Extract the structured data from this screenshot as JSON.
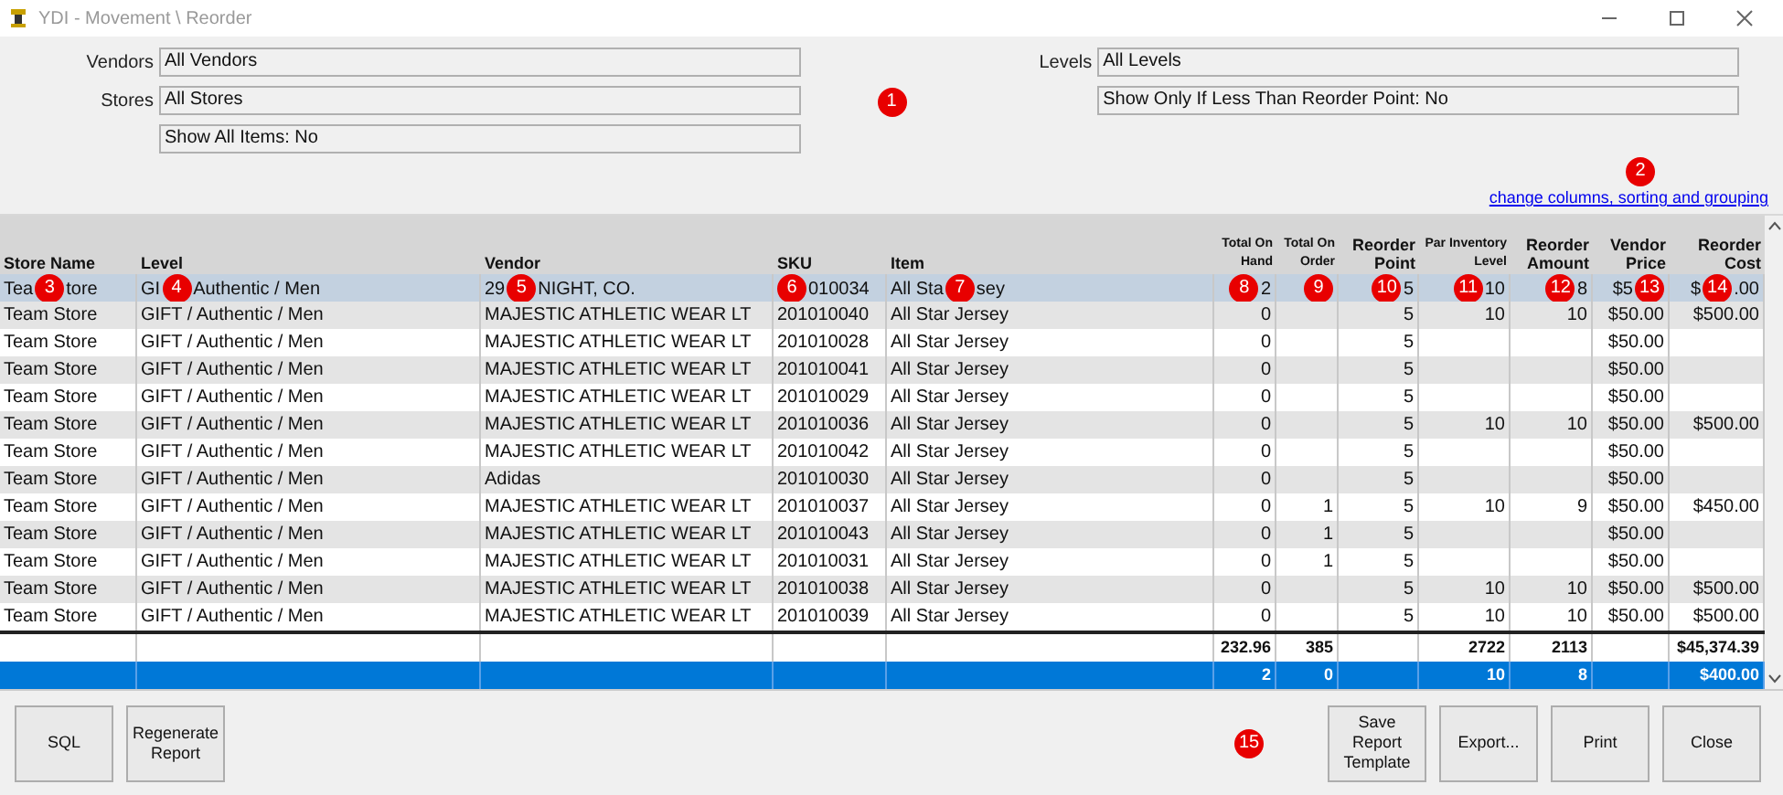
{
  "window": {
    "title": "YDI - Movement \\ Reorder"
  },
  "filters": {
    "left": [
      {
        "label": "Vendors",
        "value": "All Vendors"
      },
      {
        "label": "Stores",
        "value": "All Stores"
      },
      {
        "value": "Show All Items: No"
      }
    ],
    "callout": "1",
    "right": [
      {
        "label": "Levels",
        "value": "All Levels"
      },
      {
        "value": "Show Only If Less Than Reorder Point: No"
      }
    ]
  },
  "link_callout": "2",
  "link": "change columns, sorting and grouping",
  "table": {
    "columns": [
      {
        "label": "Store Name",
        "kind": "normal"
      },
      {
        "label": "Level",
        "kind": "normal"
      },
      {
        "label": "Vendor",
        "kind": "normal"
      },
      {
        "label": "SKU",
        "kind": "normal"
      },
      {
        "label": "Item",
        "kind": "normal"
      },
      {
        "label": "Total On Hand",
        "kind": "small"
      },
      {
        "label": "Total On Order",
        "kind": "small"
      },
      {
        "label": "Reorder Point",
        "kind": "normal"
      },
      {
        "label": "Par Inventory Level",
        "kind": "small"
      },
      {
        "label": "Reorder Amount",
        "kind": "normal"
      },
      {
        "label": "Vendor Price",
        "kind": "normal"
      },
      {
        "label": "Reorder Cost",
        "kind": "normal"
      }
    ],
    "rows": [
      {
        "selected": true,
        "cells": [
          {
            "before": "Tea",
            "callout": "3",
            "after": "tore"
          },
          {
            "before": "GI",
            "callout": "4",
            "after": "Authentic / Men"
          },
          {
            "before": "29",
            "callout": "5",
            "after": "NIGHT, CO."
          },
          {
            "callout": "6",
            "after": "010034"
          },
          {
            "before": "All Sta",
            "callout": "7",
            "after": "sey"
          },
          {
            "callout": "8",
            "after": "2"
          },
          {
            "callout": "9"
          },
          {
            "callout": "10",
            "after": "5"
          },
          {
            "callout": "11",
            "after": "10"
          },
          {
            "callout": "12",
            "after": "8"
          },
          {
            "before": "$5",
            "callout": "13"
          },
          {
            "before": "$",
            "callout": "14",
            "after": ".00"
          }
        ]
      },
      {
        "selected": false,
        "cells": [
          "Team Store",
          "GIFT / Authentic / Men",
          "MAJESTIC ATHLETIC WEAR LT",
          "201010040",
          "All Star Jersey",
          "0",
          null,
          "5",
          "10",
          "10",
          "$50.00",
          "$500.00"
        ]
      },
      {
        "selected": false,
        "cells": [
          "Team Store",
          "GIFT / Authentic / Men",
          "MAJESTIC ATHLETIC WEAR LT",
          "201010028",
          "All Star Jersey",
          "0",
          null,
          "5",
          null,
          null,
          "$50.00",
          null
        ]
      },
      {
        "selected": false,
        "cells": [
          "Team Store",
          "GIFT / Authentic / Men",
          "MAJESTIC ATHLETIC WEAR LT",
          "201010041",
          "All Star Jersey",
          "0",
          null,
          "5",
          null,
          null,
          "$50.00",
          null
        ]
      },
      {
        "selected": false,
        "cells": [
          "Team Store",
          "GIFT / Authentic / Men",
          "MAJESTIC ATHLETIC WEAR LT",
          "201010029",
          "All Star Jersey",
          "0",
          null,
          "5",
          null,
          null,
          "$50.00",
          null
        ]
      },
      {
        "selected": false,
        "cells": [
          "Team Store",
          "GIFT / Authentic / Men",
          "MAJESTIC ATHLETIC WEAR LT",
          "201010036",
          "All Star Jersey",
          "0",
          null,
          "5",
          "10",
          "10",
          "$50.00",
          "$500.00"
        ]
      },
      {
        "selected": false,
        "cells": [
          "Team Store",
          "GIFT / Authentic / Men",
          "MAJESTIC ATHLETIC WEAR LT",
          "201010042",
          "All Star Jersey",
          "0",
          null,
          "5",
          null,
          null,
          "$50.00",
          null
        ]
      },
      {
        "selected": false,
        "cells": [
          "Team Store",
          "GIFT / Authentic / Men",
          "Adidas",
          "201010030",
          "All Star Jersey",
          "0",
          null,
          "5",
          null,
          null,
          "$50.00",
          null
        ]
      },
      {
        "selected": false,
        "cells": [
          "Team Store",
          "GIFT / Authentic / Men",
          "MAJESTIC ATHLETIC WEAR LT",
          "201010037",
          "All Star Jersey",
          "0",
          "1",
          "5",
          "10",
          "9",
          "$50.00",
          "$450.00"
        ]
      },
      {
        "selected": false,
        "cells": [
          "Team Store",
          "GIFT / Authentic / Men",
          "MAJESTIC ATHLETIC WEAR LT",
          "201010043",
          "All Star Jersey",
          "0",
          "1",
          "5",
          null,
          null,
          "$50.00",
          null
        ]
      },
      {
        "selected": false,
        "cells": [
          "Team Store",
          "GIFT / Authentic / Men",
          "MAJESTIC ATHLETIC WEAR LT",
          "201010031",
          "All Star Jersey",
          "0",
          "1",
          "5",
          null,
          null,
          "$50.00",
          null
        ]
      },
      {
        "selected": false,
        "cells": [
          "Team Store",
          "GIFT / Authentic / Men",
          "MAJESTIC ATHLETIC WEAR LT",
          "201010038",
          "All Star Jersey",
          "0",
          null,
          "5",
          "10",
          "10",
          "$50.00",
          "$500.00"
        ]
      },
      {
        "selected": false,
        "cells": [
          "Team Store",
          "GIFT / Authentic / Men",
          "MAJESTIC ATHLETIC WEAR LT",
          "201010039",
          "All Star Jersey",
          "0",
          null,
          "5",
          "10",
          "10",
          "$50.00",
          "$500.00"
        ]
      }
    ],
    "totals": [
      {
        "selected": false,
        "cells": [
          null,
          null,
          null,
          null,
          null,
          "232.96",
          "385",
          null,
          "2722",
          "2113",
          null,
          "$45,374.39"
        ]
      },
      {
        "selected": true,
        "cells": [
          null,
          null,
          null,
          null,
          null,
          "2",
          "0",
          null,
          "10",
          "8",
          null,
          "$400.00"
        ]
      }
    ]
  },
  "buttons_left": [
    "SQL",
    "Regenerate Report"
  ],
  "buttons_callout": "15",
  "buttons_right": [
    "Save Report Template",
    "Export...",
    "Print",
    "Close"
  ]
}
